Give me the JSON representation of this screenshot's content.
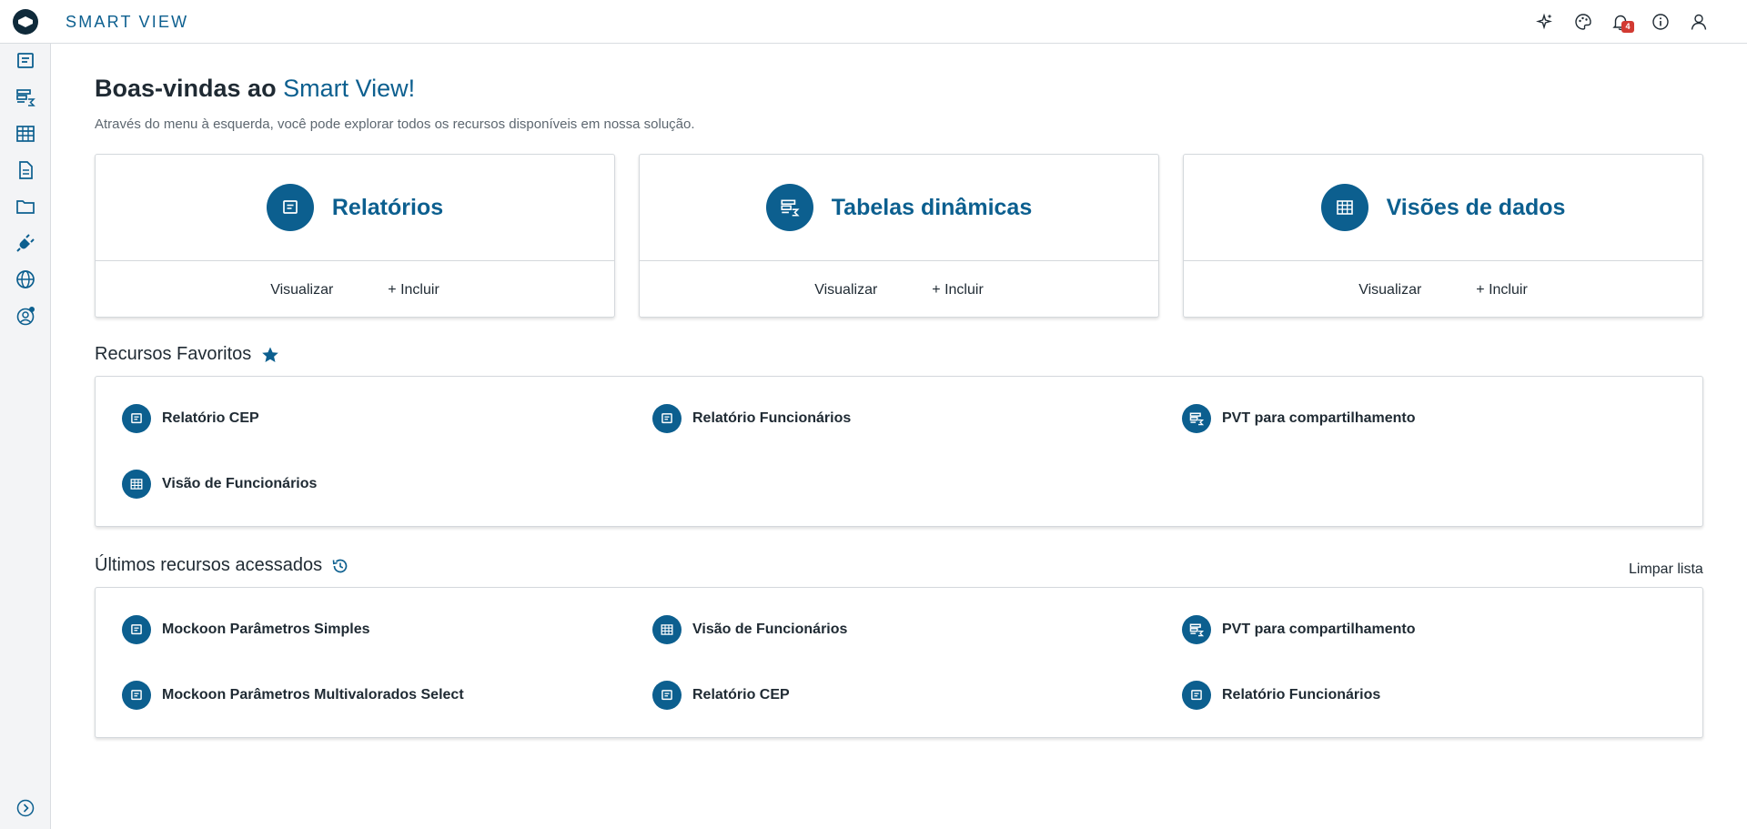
{
  "app": {
    "title": "SMART VIEW",
    "accent_color": "#0c5f8f"
  },
  "header": {
    "icons": [
      "sparkle-icon",
      "palette-icon",
      "bell-icon",
      "info-icon",
      "user-icon"
    ],
    "notifications_count": "4"
  },
  "sidebar": {
    "items": [
      "reports-icon",
      "pivot-tables-icon",
      "data-views-icon",
      "document-icon",
      "folder-icon",
      "plug-icon",
      "globe-icon",
      "user-settings-icon"
    ],
    "expand_icon": "chevron-right-circle-icon"
  },
  "welcome": {
    "prefix": "Boas-vindas ao ",
    "accent": "Smart View!",
    "subtitle": "Através do menu à esquerda, você pode explorar todos os recursos disponíveis em nossa solução."
  },
  "cards": [
    {
      "title": "Relatórios",
      "icon": "report-icon",
      "view": "Visualizar",
      "add": "+ Incluir"
    },
    {
      "title": "Tabelas dinâmicas",
      "icon": "pivot-table-icon",
      "view": "Visualizar",
      "add": "+ Incluir"
    },
    {
      "title": "Visões de dados",
      "icon": "data-view-icon",
      "view": "Visualizar",
      "add": "+ Incluir"
    }
  ],
  "favorites": {
    "title": "Recursos Favoritos",
    "items": [
      {
        "label": "Relatório CEP",
        "icon": "report-icon"
      },
      {
        "label": "Relatório Funcionários",
        "icon": "report-icon"
      },
      {
        "label": "PVT para compartilhamento",
        "icon": "pivot-table-icon"
      },
      {
        "label": "Visão de Funcionários",
        "icon": "data-view-icon"
      }
    ]
  },
  "recent": {
    "title": "Últimos recursos acessados",
    "clear_label": "Limpar lista",
    "items": [
      {
        "label": "Mockoon Parâmetros Simples",
        "icon": "report-icon"
      },
      {
        "label": "Visão de Funcionários",
        "icon": "data-view-icon"
      },
      {
        "label": "PVT para compartilhamento",
        "icon": "pivot-table-icon"
      },
      {
        "label": "Mockoon Parâmetros Multivalorados Select",
        "icon": "report-icon"
      },
      {
        "label": "Relatório CEP",
        "icon": "report-icon"
      },
      {
        "label": "Relatório Funcionários",
        "icon": "report-icon"
      }
    ]
  }
}
